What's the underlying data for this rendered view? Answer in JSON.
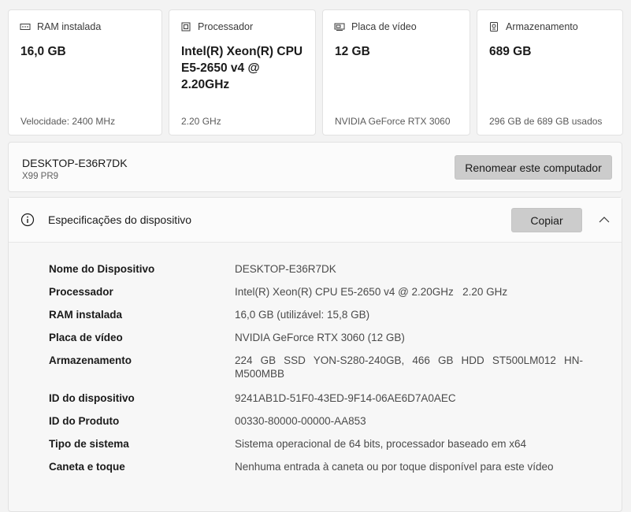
{
  "cards": [
    {
      "label": "RAM instalada",
      "icon": "ram-icon",
      "value": "16,0 GB",
      "footer": "Velocidade: 2400 MHz"
    },
    {
      "label": "Processador",
      "icon": "processor-icon",
      "value": "Intel(R) Xeon(R) CPU E5-2650 v4 @ 2.20GHz",
      "footer": "2.20 GHz"
    },
    {
      "label": "Placa de vídeo",
      "icon": "gpu-icon",
      "value": "12 GB",
      "footer": "NVIDIA GeForce RTX 3060"
    },
    {
      "label": "Armazenamento",
      "icon": "storage-icon",
      "value": "689 GB",
      "footer": "296 GB de 689 GB usados"
    }
  ],
  "device": {
    "name": "DESKTOP-E36R7DK",
    "model": "X99 PR9",
    "rename_label": "Renomear este computador"
  },
  "specs": {
    "title": "Especificações do dispositivo",
    "copy_label": "Copiar",
    "rows": [
      {
        "key": "Nome do Dispositivo",
        "value": "DESKTOP-E36R7DK"
      },
      {
        "key": "Processador",
        "value": "Intel(R) Xeon(R) CPU E5-2650 v4 @ 2.20GHz   2.20 GHz"
      },
      {
        "key": "RAM instalada",
        "value": "16,0 GB (utilizável: 15,8 GB)"
      },
      {
        "key": "Placa de vídeo",
        "value": "NVIDIA GeForce RTX 3060 (12 GB)"
      },
      {
        "key": "Armazenamento",
        "value": "224 GB SSD YON-S280-240GB, 466 GB HDD ST500LM012 HN-M500MBB"
      },
      {
        "key": "ID do dispositivo",
        "value": "9241AB1D-51F0-43ED-9F14-06AE6D7A0AEC"
      },
      {
        "key": "ID do Produto",
        "value": "00330-80000-00000-AA853"
      },
      {
        "key": "Tipo de sistema",
        "value": "Sistema operacional de 64 bits, processador baseado em x64"
      },
      {
        "key": "Caneta e toque",
        "value": "Nenhuma entrada à caneta ou por toque disponível para este vídeo"
      }
    ]
  },
  "colors": {
    "background": "#f3f3f3",
    "card": "#ffffff",
    "button": "#cccccc",
    "text": "#1a1a1a",
    "muted": "#5a5a5a"
  }
}
